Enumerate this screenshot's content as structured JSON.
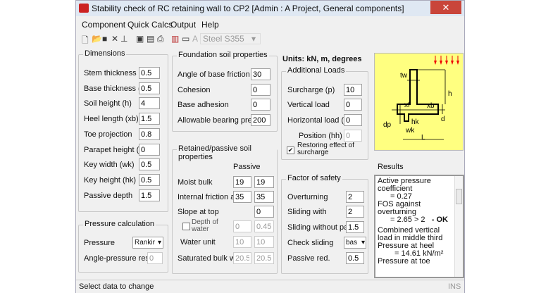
{
  "window": {
    "title": "Stability check of RC retaining wall to CP2 [Admin : A Project, General components]",
    "close": "✕"
  },
  "menu": [
    "Component",
    "Quick Calcs",
    "Output",
    "Help"
  ],
  "toolbar": {
    "icons": [
      "new-icon",
      "open-icon",
      "save-icon",
      "delete-icon",
      "axis-icon",
      "preview-icon",
      "report-icon",
      "print-icon",
      "books-icon",
      "comment-icon",
      "font-icon"
    ],
    "material": "Steel S355"
  },
  "units": "Units: kN, m, degrees",
  "dimensions": {
    "title": "Dimensions",
    "rows": [
      {
        "label": "Stem thickness",
        "value": "0.5"
      },
      {
        "label": "Base thickness (",
        "value": "0.5"
      },
      {
        "label": "Soil height (h)",
        "value": "4"
      },
      {
        "label": "Heel length (xb)",
        "value": "1.5"
      },
      {
        "label": "Toe projection",
        "value": "0.8"
      },
      {
        "label": "Parapet height (",
        "value": "0"
      },
      {
        "label": "Key width (wk)",
        "value": "0.5"
      },
      {
        "label": "Key height (hk)",
        "value": "0.5"
      },
      {
        "label": "Passive depth",
        "value": "1.5"
      }
    ]
  },
  "pressure": {
    "title": "Pressure calculation",
    "pressure_label": "Pressure",
    "pressure_value": "Rankir",
    "angle_label": "Angle-pressure res",
    "angle_value": "0"
  },
  "foundation": {
    "title": "Foundation soil properties",
    "rows": [
      {
        "label": "Angle of base friction",
        "value": "30"
      },
      {
        "label": "Cohesion",
        "value": "0"
      },
      {
        "label": "Base adhesion",
        "value": "0"
      },
      {
        "label": "Allowable bearing pres",
        "value": "200"
      }
    ]
  },
  "retained": {
    "title": "Retained/passive soil properties",
    "passive_header": "Passive",
    "moist": {
      "label": "Moist bulk",
      "a": "19",
      "b": "19"
    },
    "friction": {
      "label": "Internal friction a",
      "a": "35",
      "b": "35"
    },
    "slope": {
      "label": "Slope at top",
      "b": "0"
    },
    "water_depth": {
      "label": "Depth of water",
      "a": "0",
      "b": "0.45"
    },
    "water_unit": {
      "label": "Water unit",
      "a": "10",
      "b": "10"
    },
    "saturated": {
      "label": "Saturated bulk w",
      "a": "20.5",
      "b": "20.5"
    }
  },
  "loads": {
    "title": "Additional Loads",
    "rows": [
      {
        "label": "Surcharge (p)",
        "value": "10"
      },
      {
        "label": "Vertical load",
        "value": "0"
      },
      {
        "label": "Horizontal load (",
        "value": "0"
      },
      {
        "label": "Position (hh)",
        "value": "0"
      }
    ],
    "restoring": "Restoring effect of surcharge"
  },
  "fos": {
    "title": "Factor of safety",
    "overturning": {
      "label": "Overturning",
      "value": "2"
    },
    "sliding_with": {
      "label": "Sliding with",
      "value": "2"
    },
    "sliding_without": {
      "label": "Sliding without pa",
      "value": "1.5"
    },
    "check_sliding": {
      "label": "Check sliding",
      "value": "bas"
    },
    "passive_red": {
      "label": "Passive red.",
      "value": "0.5"
    }
  },
  "diagram_labels": {
    "tw": "tw",
    "h": "h",
    "xf": "xf",
    "xb": "xb",
    "dp": "dp",
    "hk": "hk",
    "wk": "wk",
    "d": "d",
    "L": "L"
  },
  "results": {
    "title": "Results",
    "lines": [
      "Active pressure coefficient",
      "= 0.27",
      "FOS against overturning",
      "= 2.65  > 2",
      "- OK",
      "Combined vertical load in middle third",
      "Pressure at heel",
      "= 14.61 kN/m²",
      "Pressure at toe"
    ]
  },
  "status": {
    "text": "Select data to change",
    "ins": "INS"
  },
  "colors": {
    "diagram_bg": "#ffff80",
    "close": "#c9453a",
    "arrows": "#e00000"
  }
}
